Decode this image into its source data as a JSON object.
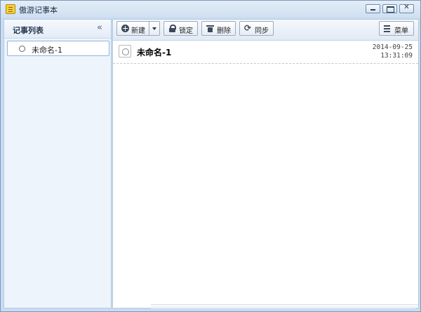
{
  "window": {
    "title": "傲游记事本"
  },
  "sidebar": {
    "title": "记事列表",
    "items": [
      {
        "label": "未命名-1"
      }
    ]
  },
  "toolbar": {
    "new_label": "新建",
    "lock_label": "锁定",
    "delete_label": "删除",
    "sync_label": "同步",
    "menu_label": "菜单"
  },
  "note": {
    "title": "未命名-1",
    "date": "2014-09-25",
    "time": "13:31:09"
  },
  "icons": {
    "app": "notepad-icon",
    "collapse": "double-chevron-left-icon",
    "new": "plus-circle-icon",
    "lock": "lock-icon",
    "delete": "trash-icon",
    "sync": "refresh-icon",
    "menu": "list-icon"
  }
}
